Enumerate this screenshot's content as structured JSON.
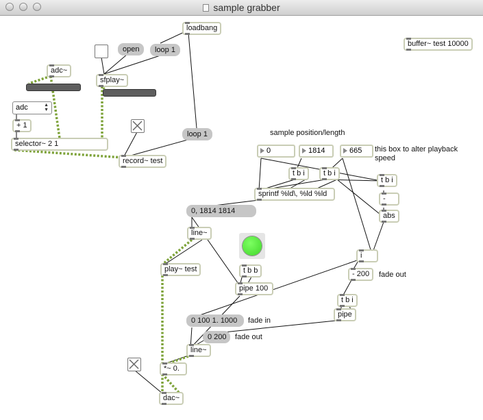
{
  "window": {
    "title": "sample grabber"
  },
  "objects": {
    "loadbang": "loadbang",
    "buffer": "buffer~ test 10000",
    "adc": "adc~",
    "sfplay": "sfplay~",
    "plus1": "+ 1",
    "selector": "selector~ 2 1",
    "record": "record~ test",
    "tbi1": "t b i",
    "tbi2": "t b i",
    "tbi3": "t b i",
    "sprintf": "sprintf %ld\\, %ld %ld",
    "minus": "-",
    "abs": "abs",
    "i": "i",
    "minus200": "- 200",
    "tbi4": "t b i",
    "pipe": "pipe",
    "line1": "line~",
    "play": "play~ test",
    "tbb": "t b b",
    "pipe100": "pipe 100",
    "line2": "line~",
    "times": "*~ 0.",
    "dac": "dac~"
  },
  "messages": {
    "open": "open",
    "loop1_top": "loop 1",
    "loop1_mid": "loop 1",
    "list": "0, 1814 1814",
    "fade_in": "0 100 1. 1000",
    "fade_out": "0 200"
  },
  "numbers": {
    "n1": "0",
    "n2": "1814",
    "n3": "665"
  },
  "comments": {
    "sample_position": "sample position/length",
    "alter_speed": "this box to alter playback speed",
    "fade_out_1": "fade out",
    "fade_in": "fade in",
    "fade_out_2": "fade out"
  },
  "menu": {
    "selected": "adc"
  },
  "colors": {
    "signal_cord": "#7ea33a",
    "control_cord": "#111111",
    "led": "#4ee02f"
  }
}
